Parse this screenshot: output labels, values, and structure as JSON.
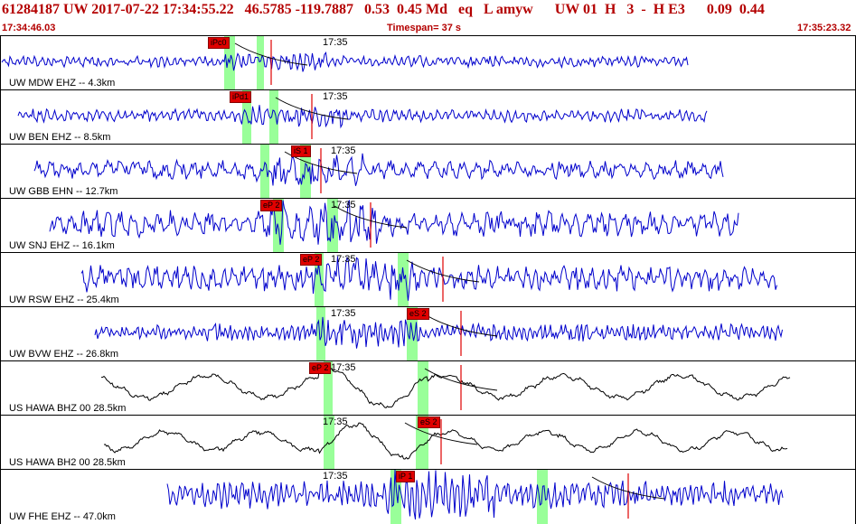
{
  "header": {
    "title": "61284187 UW 2017-07-22 17:34:55.22   46.5785 -119.7887   0.53  0.45 Md   eq   L amyw      UW 01  H   3  -  H E3      0.09  0.44",
    "start_time": "17:34:46.03",
    "timespan": "Timespan=  37 s",
    "end_time": "17:35:23.32"
  },
  "time_label": "17:35",
  "colors": {
    "header_text": "#b40000",
    "trace_blue": "#0000cc",
    "trace_black": "#000000",
    "pick_red": "#e00000",
    "window_green": "#99ff99"
  },
  "traces": [
    {
      "station": "UW MDW EHZ -- 4.3km",
      "picks": [
        "iPc0"
      ],
      "color": "blue"
    },
    {
      "station": "UW BEN EHZ -- 8.5km",
      "picks": [
        "iPd1"
      ],
      "color": "blue"
    },
    {
      "station": "UW GBB EHN -- 12.7km",
      "picks": [
        "iS 1"
      ],
      "color": "blue"
    },
    {
      "station": "UW SNJ EHZ -- 16.1km",
      "picks": [
        "eP 2"
      ],
      "color": "blue"
    },
    {
      "station": "UW RSW EHZ -- 25.4km",
      "picks": [
        "eP 2"
      ],
      "color": "blue"
    },
    {
      "station": "UW BVW EHZ -- 26.8km",
      "picks": [
        "eS 2"
      ],
      "color": "blue"
    },
    {
      "station": "US HAWA BHZ 00 28.5km",
      "picks": [
        "eP 2"
      ],
      "color": "black"
    },
    {
      "station": "US HAWA BH2 00 28.5km",
      "picks": [
        "eS 2"
      ],
      "color": "black"
    },
    {
      "station": "UW FHE EHZ -- 47.0km",
      "picks": [
        "iP 1"
      ],
      "color": "blue"
    }
  ]
}
